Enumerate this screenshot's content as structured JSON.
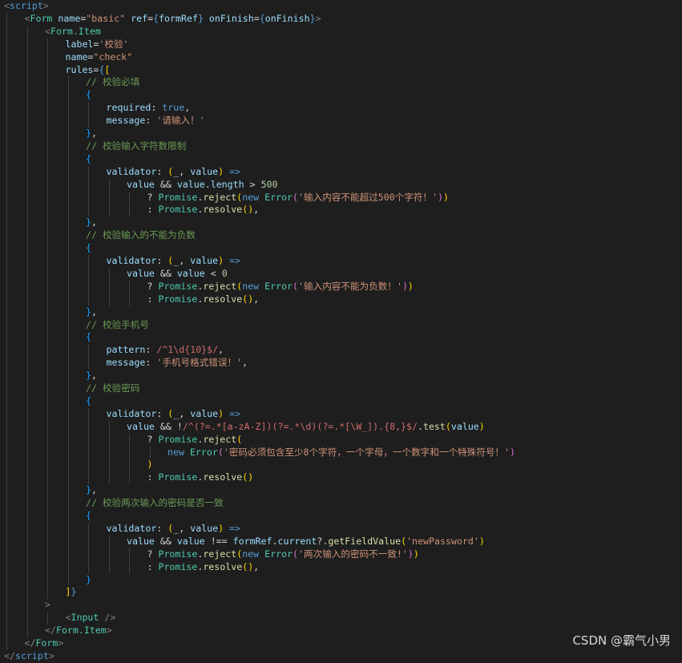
{
  "colors": {
    "bg": "#1e1e1e",
    "tag": "#569cd6",
    "component": "#4ec9b0",
    "attr": "#9cdcfe",
    "string": "#ce9178",
    "comment": "#6a9955",
    "keyword": "#569cd6",
    "punct": "#808080",
    "text": "#d4d4d4",
    "bracket1": "#ffd700",
    "bracket2": "#da70d6",
    "bracket3": "#179fff",
    "number": "#b5cea8",
    "function": "#dcdcaa",
    "regex": "#d16969"
  },
  "watermark": "CSDN @霸气小男",
  "lines": [
    {
      "indent": 0,
      "tokens": [
        {
          "t": "<",
          "c": "punct"
        },
        {
          "t": "script",
          "c": "tag"
        },
        {
          "t": ">",
          "c": "punct"
        }
      ]
    },
    {
      "indent": 1,
      "tokens": [
        {
          "t": "<",
          "c": "punct"
        },
        {
          "t": "Form",
          "c": "component"
        },
        {
          "t": " ",
          "c": "text"
        },
        {
          "t": "name",
          "c": "attr"
        },
        {
          "t": "=",
          "c": "text"
        },
        {
          "t": "\"basic\"",
          "c": "string"
        },
        {
          "t": " ",
          "c": "text"
        },
        {
          "t": "ref",
          "c": "attr"
        },
        {
          "t": "=",
          "c": "text"
        },
        {
          "t": "{",
          "c": "keyword"
        },
        {
          "t": "formRef",
          "c": "attr"
        },
        {
          "t": "}",
          "c": "keyword"
        },
        {
          "t": " ",
          "c": "text"
        },
        {
          "t": "onFinish",
          "c": "attr"
        },
        {
          "t": "=",
          "c": "text"
        },
        {
          "t": "{",
          "c": "keyword"
        },
        {
          "t": "onFinish",
          "c": "attr"
        },
        {
          "t": "}",
          "c": "keyword"
        },
        {
          "t": ">",
          "c": "punct"
        }
      ]
    },
    {
      "indent": 2,
      "tokens": [
        {
          "t": "<",
          "c": "punct"
        },
        {
          "t": "Form.Item",
          "c": "component"
        }
      ]
    },
    {
      "indent": 3,
      "tokens": [
        {
          "t": "label",
          "c": "attr"
        },
        {
          "t": "=",
          "c": "text"
        },
        {
          "t": "'校验'",
          "c": "string"
        }
      ]
    },
    {
      "indent": 3,
      "tokens": [
        {
          "t": "name",
          "c": "attr"
        },
        {
          "t": "=",
          "c": "text"
        },
        {
          "t": "\"check\"",
          "c": "string"
        }
      ]
    },
    {
      "indent": 3,
      "tokens": [
        {
          "t": "rules",
          "c": "attr"
        },
        {
          "t": "=",
          "c": "text"
        },
        {
          "t": "{",
          "c": "keyword"
        },
        {
          "t": "[",
          "c": "bracket1"
        }
      ]
    },
    {
      "indent": 4,
      "tokens": [
        {
          "t": "// 校验必填",
          "c": "comment"
        }
      ]
    },
    {
      "indent": 4,
      "tokens": [
        {
          "t": "{",
          "c": "bracket3"
        }
      ]
    },
    {
      "indent": 5,
      "tokens": [
        {
          "t": "required",
          "c": "attr"
        },
        {
          "t": ": ",
          "c": "text"
        },
        {
          "t": "true",
          "c": "keyword"
        },
        {
          "t": ",",
          "c": "text"
        }
      ]
    },
    {
      "indent": 5,
      "tokens": [
        {
          "t": "message",
          "c": "attr"
        },
        {
          "t": ": ",
          "c": "text"
        },
        {
          "t": "'请输入！'",
          "c": "string"
        }
      ]
    },
    {
      "indent": 4,
      "tokens": [
        {
          "t": "}",
          "c": "bracket3"
        },
        {
          "t": ",",
          "c": "text"
        }
      ]
    },
    {
      "indent": 4,
      "tokens": [
        {
          "t": "// 校验输入字符数限制",
          "c": "comment"
        }
      ]
    },
    {
      "indent": 4,
      "tokens": [
        {
          "t": "{",
          "c": "bracket3"
        }
      ]
    },
    {
      "indent": 5,
      "tokens": [
        {
          "t": "validator",
          "c": "attr"
        },
        {
          "t": ": ",
          "c": "text"
        },
        {
          "t": "(",
          "c": "bracket1"
        },
        {
          "t": "_",
          "c": "attr"
        },
        {
          "t": ", ",
          "c": "text"
        },
        {
          "t": "value",
          "c": "attr"
        },
        {
          "t": ")",
          "c": "bracket1"
        },
        {
          "t": " ",
          "c": "text"
        },
        {
          "t": "=>",
          "c": "keyword"
        }
      ]
    },
    {
      "indent": 6,
      "tokens": [
        {
          "t": "value",
          "c": "attr"
        },
        {
          "t": " && ",
          "c": "text"
        },
        {
          "t": "value",
          "c": "attr"
        },
        {
          "t": ".",
          "c": "text"
        },
        {
          "t": "length",
          "c": "attr"
        },
        {
          "t": " > ",
          "c": "text"
        },
        {
          "t": "500",
          "c": "number"
        }
      ]
    },
    {
      "indent": 7,
      "tokens": [
        {
          "t": "? ",
          "c": "text"
        },
        {
          "t": "Promise",
          "c": "component"
        },
        {
          "t": ".",
          "c": "text"
        },
        {
          "t": "reject",
          "c": "function"
        },
        {
          "t": "(",
          "c": "bracket1"
        },
        {
          "t": "new",
          "c": "keyword"
        },
        {
          "t": " ",
          "c": "text"
        },
        {
          "t": "Error",
          "c": "component"
        },
        {
          "t": "(",
          "c": "bracket2"
        },
        {
          "t": "'输入内容不能超过500个字符！'",
          "c": "string"
        },
        {
          "t": ")",
          "c": "bracket2"
        },
        {
          "t": ")",
          "c": "bracket1"
        }
      ]
    },
    {
      "indent": 7,
      "tokens": [
        {
          "t": ": ",
          "c": "text"
        },
        {
          "t": "Promise",
          "c": "component"
        },
        {
          "t": ".",
          "c": "text"
        },
        {
          "t": "resolve",
          "c": "function"
        },
        {
          "t": "(",
          "c": "bracket1"
        },
        {
          "t": ")",
          "c": "bracket1"
        },
        {
          "t": ",",
          "c": "text"
        }
      ]
    },
    {
      "indent": 4,
      "tokens": [
        {
          "t": "}",
          "c": "bracket3"
        },
        {
          "t": ",",
          "c": "text"
        }
      ]
    },
    {
      "indent": 4,
      "tokens": [
        {
          "t": "// 校验输入的不能为负数",
          "c": "comment"
        }
      ]
    },
    {
      "indent": 4,
      "tokens": [
        {
          "t": "{",
          "c": "bracket3"
        }
      ]
    },
    {
      "indent": 5,
      "tokens": [
        {
          "t": "validator",
          "c": "attr"
        },
        {
          "t": ": ",
          "c": "text"
        },
        {
          "t": "(",
          "c": "bracket1"
        },
        {
          "t": "_",
          "c": "attr"
        },
        {
          "t": ", ",
          "c": "text"
        },
        {
          "t": "value",
          "c": "attr"
        },
        {
          "t": ")",
          "c": "bracket1"
        },
        {
          "t": " ",
          "c": "text"
        },
        {
          "t": "=>",
          "c": "keyword"
        }
      ]
    },
    {
      "indent": 6,
      "tokens": [
        {
          "t": "value",
          "c": "attr"
        },
        {
          "t": " && ",
          "c": "text"
        },
        {
          "t": "value",
          "c": "attr"
        },
        {
          "t": " < ",
          "c": "text"
        },
        {
          "t": "0",
          "c": "number"
        }
      ]
    },
    {
      "indent": 7,
      "tokens": [
        {
          "t": "? ",
          "c": "text"
        },
        {
          "t": "Promise",
          "c": "component"
        },
        {
          "t": ".",
          "c": "text"
        },
        {
          "t": "reject",
          "c": "function"
        },
        {
          "t": "(",
          "c": "bracket1"
        },
        {
          "t": "new",
          "c": "keyword"
        },
        {
          "t": " ",
          "c": "text"
        },
        {
          "t": "Error",
          "c": "component"
        },
        {
          "t": "(",
          "c": "bracket2"
        },
        {
          "t": "'输入内容不能为负数！'",
          "c": "string"
        },
        {
          "t": ")",
          "c": "bracket2"
        },
        {
          "t": ")",
          "c": "bracket1"
        }
      ]
    },
    {
      "indent": 7,
      "tokens": [
        {
          "t": ": ",
          "c": "text"
        },
        {
          "t": "Promise",
          "c": "component"
        },
        {
          "t": ".",
          "c": "text"
        },
        {
          "t": "resolve",
          "c": "function"
        },
        {
          "t": "(",
          "c": "bracket1"
        },
        {
          "t": ")",
          "c": "bracket1"
        },
        {
          "t": ",",
          "c": "text"
        }
      ]
    },
    {
      "indent": 4,
      "tokens": [
        {
          "t": "}",
          "c": "bracket3"
        },
        {
          "t": ",",
          "c": "text"
        }
      ]
    },
    {
      "indent": 4,
      "tokens": [
        {
          "t": "// 校验手机号",
          "c": "comment"
        }
      ]
    },
    {
      "indent": 4,
      "tokens": [
        {
          "t": "{",
          "c": "bracket3"
        }
      ]
    },
    {
      "indent": 5,
      "tokens": [
        {
          "t": "pattern",
          "c": "attr"
        },
        {
          "t": ": ",
          "c": "text"
        },
        {
          "t": "/^1\\d{10}$/",
          "c": "regex"
        },
        {
          "t": ",",
          "c": "text"
        }
      ]
    },
    {
      "indent": 5,
      "tokens": [
        {
          "t": "message",
          "c": "attr"
        },
        {
          "t": ": ",
          "c": "text"
        },
        {
          "t": "'手机号格式错误！'",
          "c": "string"
        },
        {
          "t": ",",
          "c": "text"
        }
      ]
    },
    {
      "indent": 4,
      "tokens": [
        {
          "t": "}",
          "c": "bracket3"
        },
        {
          "t": ",",
          "c": "text"
        }
      ]
    },
    {
      "indent": 4,
      "tokens": [
        {
          "t": "// 校验密码",
          "c": "comment"
        }
      ]
    },
    {
      "indent": 4,
      "tokens": [
        {
          "t": "{",
          "c": "bracket3"
        }
      ]
    },
    {
      "indent": 5,
      "tokens": [
        {
          "t": "validator",
          "c": "attr"
        },
        {
          "t": ": ",
          "c": "text"
        },
        {
          "t": "(",
          "c": "bracket1"
        },
        {
          "t": "_",
          "c": "attr"
        },
        {
          "t": ", ",
          "c": "text"
        },
        {
          "t": "value",
          "c": "attr"
        },
        {
          "t": ")",
          "c": "bracket1"
        },
        {
          "t": " ",
          "c": "text"
        },
        {
          "t": "=>",
          "c": "keyword"
        }
      ]
    },
    {
      "indent": 6,
      "tokens": [
        {
          "t": "value",
          "c": "attr"
        },
        {
          "t": " && !",
          "c": "text"
        },
        {
          "t": "/^(?=.*[a-zA-Z])(?=.*\\d)(?=.*[\\W_]).{8,}$/",
          "c": "regex"
        },
        {
          "t": ".",
          "c": "text"
        },
        {
          "t": "test",
          "c": "function"
        },
        {
          "t": "(",
          "c": "bracket1"
        },
        {
          "t": "value",
          "c": "attr"
        },
        {
          "t": ")",
          "c": "bracket1"
        }
      ]
    },
    {
      "indent": 7,
      "tokens": [
        {
          "t": "? ",
          "c": "text"
        },
        {
          "t": "Promise",
          "c": "component"
        },
        {
          "t": ".",
          "c": "text"
        },
        {
          "t": "reject",
          "c": "function"
        },
        {
          "t": "(",
          "c": "bracket1"
        }
      ]
    },
    {
      "indent": 8,
      "tokens": [
        {
          "t": "new",
          "c": "keyword"
        },
        {
          "t": " ",
          "c": "text"
        },
        {
          "t": "Error",
          "c": "component"
        },
        {
          "t": "(",
          "c": "bracket2"
        },
        {
          "t": "'密码必须包含至少8个字符，一个字母，一个数字和一个特殊符号！'",
          "c": "string"
        },
        {
          "t": ")",
          "c": "bracket2"
        }
      ]
    },
    {
      "indent": 7,
      "tokens": [
        {
          "t": ")",
          "c": "bracket1"
        }
      ]
    },
    {
      "indent": 7,
      "tokens": [
        {
          "t": ": ",
          "c": "text"
        },
        {
          "t": "Promise",
          "c": "component"
        },
        {
          "t": ".",
          "c": "text"
        },
        {
          "t": "resolve",
          "c": "function"
        },
        {
          "t": "(",
          "c": "bracket1"
        },
        {
          "t": ")",
          "c": "bracket1"
        }
      ]
    },
    {
      "indent": 4,
      "tokens": [
        {
          "t": "}",
          "c": "bracket3"
        },
        {
          "t": ",",
          "c": "text"
        }
      ]
    },
    {
      "indent": 4,
      "tokens": [
        {
          "t": "// 校验两次输入的密码是否一致",
          "c": "comment"
        }
      ]
    },
    {
      "indent": 4,
      "tokens": [
        {
          "t": "{",
          "c": "bracket3"
        }
      ]
    },
    {
      "indent": 5,
      "tokens": [
        {
          "t": "validator",
          "c": "attr"
        },
        {
          "t": ": ",
          "c": "text"
        },
        {
          "t": "(",
          "c": "bracket1"
        },
        {
          "t": "_",
          "c": "attr"
        },
        {
          "t": ", ",
          "c": "text"
        },
        {
          "t": "value",
          "c": "attr"
        },
        {
          "t": ")",
          "c": "bracket1"
        },
        {
          "t": " ",
          "c": "text"
        },
        {
          "t": "=>",
          "c": "keyword"
        }
      ]
    },
    {
      "indent": 6,
      "tokens": [
        {
          "t": "value",
          "c": "attr"
        },
        {
          "t": " && ",
          "c": "text"
        },
        {
          "t": "value",
          "c": "attr"
        },
        {
          "t": " !== ",
          "c": "text"
        },
        {
          "t": "formRef",
          "c": "attr"
        },
        {
          "t": ".",
          "c": "text"
        },
        {
          "t": "current",
          "c": "attr"
        },
        {
          "t": "?.",
          "c": "text"
        },
        {
          "t": "getFieldValue",
          "c": "function"
        },
        {
          "t": "(",
          "c": "bracket1"
        },
        {
          "t": "'newPassword'",
          "c": "string"
        },
        {
          "t": ")",
          "c": "bracket1"
        }
      ]
    },
    {
      "indent": 7,
      "tokens": [
        {
          "t": "? ",
          "c": "text"
        },
        {
          "t": "Promise",
          "c": "component"
        },
        {
          "t": ".",
          "c": "text"
        },
        {
          "t": "reject",
          "c": "function"
        },
        {
          "t": "(",
          "c": "bracket1"
        },
        {
          "t": "new",
          "c": "keyword"
        },
        {
          "t": " ",
          "c": "text"
        },
        {
          "t": "Error",
          "c": "component"
        },
        {
          "t": "(",
          "c": "bracket2"
        },
        {
          "t": "'两次输入的密码不一致!'",
          "c": "string"
        },
        {
          "t": ")",
          "c": "bracket2"
        },
        {
          "t": ")",
          "c": "bracket1"
        }
      ]
    },
    {
      "indent": 7,
      "tokens": [
        {
          "t": ": ",
          "c": "text"
        },
        {
          "t": "Promise",
          "c": "component"
        },
        {
          "t": ".",
          "c": "text"
        },
        {
          "t": "resolve",
          "c": "function"
        },
        {
          "t": "(",
          "c": "bracket1"
        },
        {
          "t": ")",
          "c": "bracket1"
        },
        {
          "t": ",",
          "c": "text"
        }
      ]
    },
    {
      "indent": 4,
      "tokens": [
        {
          "t": "}",
          "c": "bracket3"
        }
      ]
    },
    {
      "indent": 3,
      "tokens": [
        {
          "t": "]",
          "c": "bracket1"
        },
        {
          "t": "}",
          "c": "keyword"
        }
      ]
    },
    {
      "indent": 2,
      "tokens": [
        {
          "t": ">",
          "c": "punct"
        }
      ]
    },
    {
      "indent": 3,
      "tokens": [
        {
          "t": "<",
          "c": "punct"
        },
        {
          "t": "Input",
          "c": "component"
        },
        {
          "t": " />",
          "c": "punct"
        }
      ]
    },
    {
      "indent": 2,
      "tokens": [
        {
          "t": "</",
          "c": "punct"
        },
        {
          "t": "Form.Item",
          "c": "component"
        },
        {
          "t": ">",
          "c": "punct"
        }
      ]
    },
    {
      "indent": 1,
      "tokens": [
        {
          "t": "</",
          "c": "punct"
        },
        {
          "t": "Form",
          "c": "component"
        },
        {
          "t": ">",
          "c": "punct"
        }
      ]
    },
    {
      "indent": 0,
      "tokens": [
        {
          "t": "</",
          "c": "punct"
        },
        {
          "t": "script",
          "c": "tag"
        },
        {
          "t": ">",
          "c": "punct"
        }
      ]
    }
  ]
}
